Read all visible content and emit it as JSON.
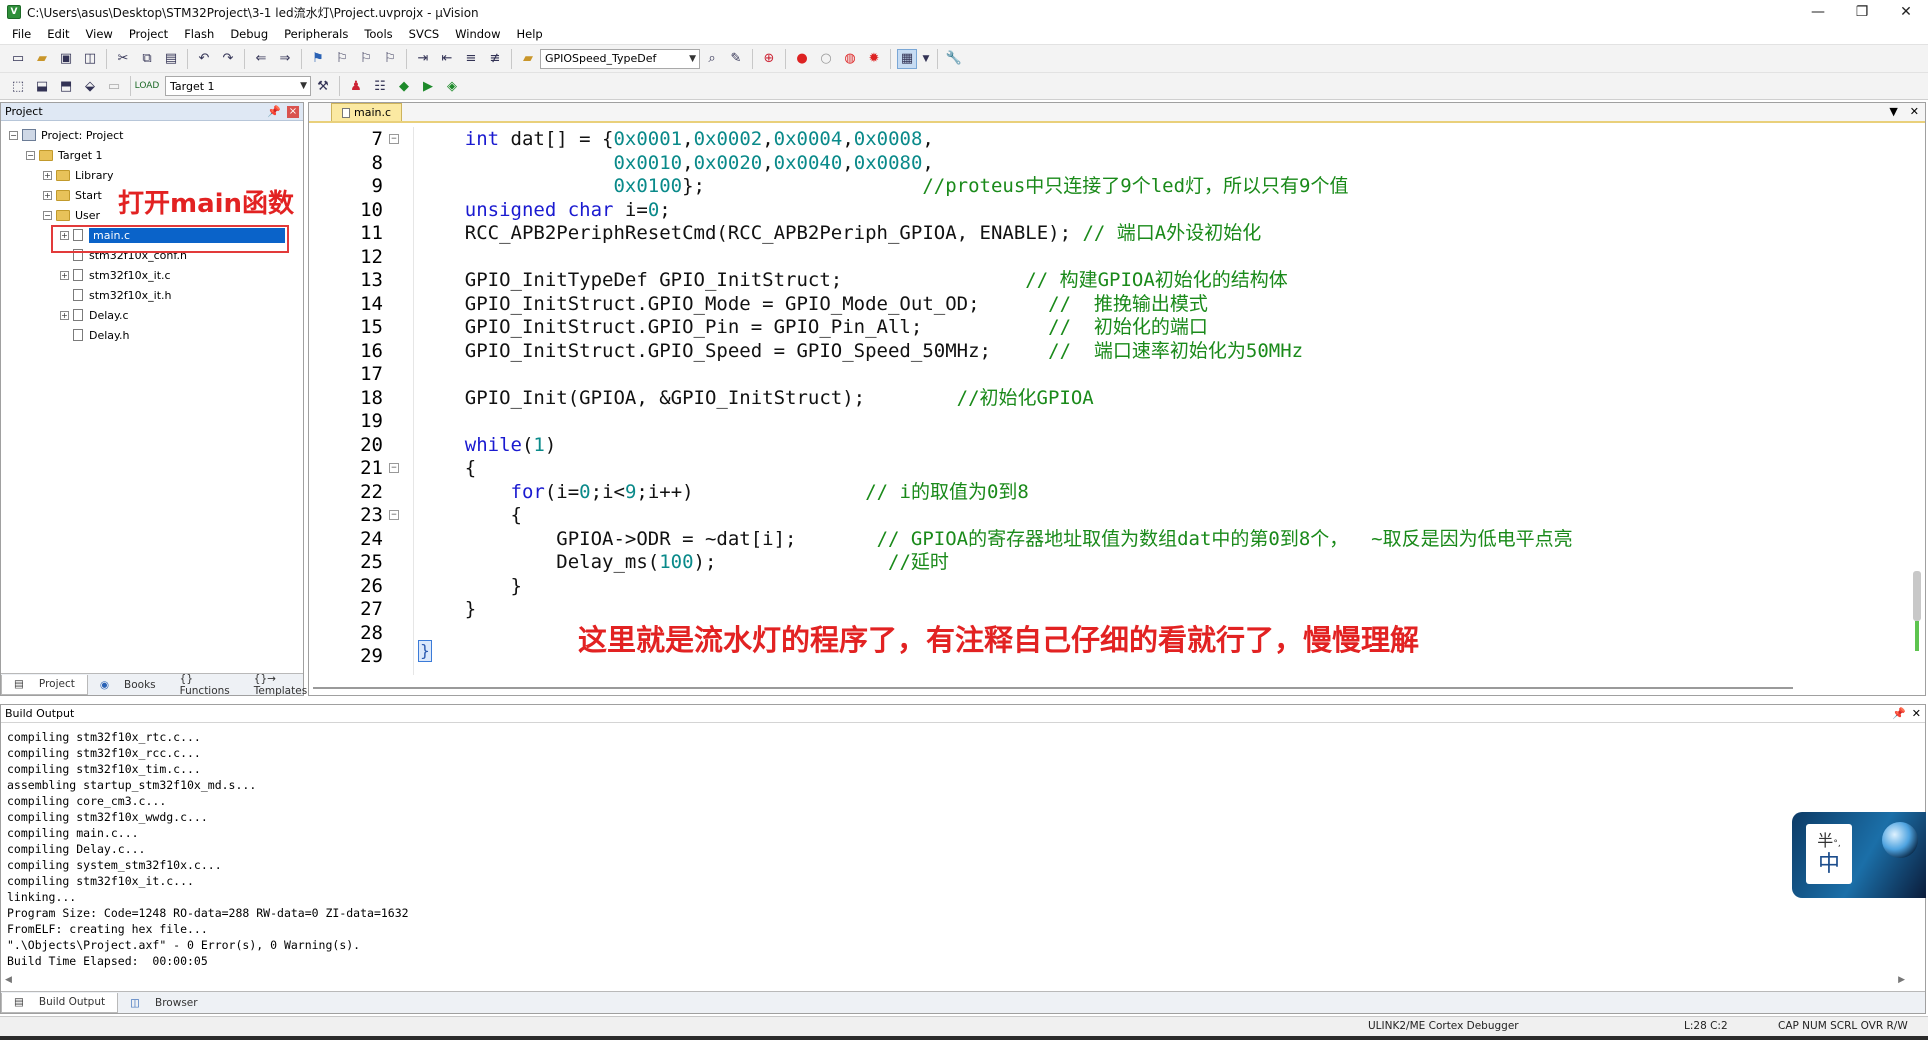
{
  "window": {
    "title": "C:\\Users\\asus\\Desktop\\STM32Project\\3-1 led流水灯\\Project.uvprojx - µVision",
    "controls": [
      "—",
      "❐",
      "✕"
    ]
  },
  "menu": [
    "File",
    "Edit",
    "View",
    "Project",
    "Flash",
    "Debug",
    "Peripherals",
    "Tools",
    "SVCS",
    "Window",
    "Help"
  ],
  "toolbar": {
    "find_combo": "GPIOSpeed_TypeDef",
    "target_combo": "Target 1"
  },
  "project_pane": {
    "header": "Project",
    "tree": [
      {
        "label": "Project: Project",
        "indent": 0,
        "kind": "project",
        "exp": "−"
      },
      {
        "label": "Target 1",
        "indent": 1,
        "kind": "folder",
        "exp": "−"
      },
      {
        "label": "Library",
        "indent": 2,
        "kind": "folder",
        "exp": "+"
      },
      {
        "label": "Start",
        "indent": 2,
        "kind": "folder",
        "exp": "+"
      },
      {
        "label": "User",
        "indent": 2,
        "kind": "folder",
        "exp": "−"
      },
      {
        "label": "main.c",
        "indent": 3,
        "kind": "file",
        "exp": "+",
        "selected": true
      },
      {
        "label": "stm32f10x_conf.h",
        "indent": 3,
        "kind": "file",
        "exp": ""
      },
      {
        "label": "stm32f10x_it.c",
        "indent": 3,
        "kind": "file",
        "exp": "+"
      },
      {
        "label": "stm32f10x_it.h",
        "indent": 3,
        "kind": "file",
        "exp": ""
      },
      {
        "label": "Delay.c",
        "indent": 3,
        "kind": "file",
        "exp": "+"
      },
      {
        "label": "Delay.h",
        "indent": 3,
        "kind": "file",
        "exp": ""
      }
    ],
    "annotation": "打开main函数",
    "tabs": [
      "Project",
      "Books",
      "{} Functions",
      "{}→ Templates"
    ]
  },
  "editor": {
    "tab": "main.c",
    "annotation": "这里就是流水灯的程序了，有注释自己仔细的看就行了，慢慢理解",
    "caret_char": "}",
    "lines": [
      {
        "n": "7",
        "fold": "−",
        "segs": [
          [
            "",
            "    "
          ],
          [
            "kw",
            "int"
          ],
          [
            "",
            " dat[] = {"
          ],
          [
            "num",
            "0x0001"
          ],
          [
            "",
            ","
          ],
          [
            "num",
            "0x0002"
          ],
          [
            "",
            ","
          ],
          [
            "num",
            "0x0004"
          ],
          [
            "",
            ","
          ],
          [
            "num",
            "0x0008"
          ],
          [
            "",
            ","
          ]
        ]
      },
      {
        "n": "8",
        "fold": "",
        "segs": [
          [
            "",
            "                 "
          ],
          [
            "num",
            "0x0010"
          ],
          [
            "",
            ","
          ],
          [
            "num",
            "0x0020"
          ],
          [
            "",
            ","
          ],
          [
            "num",
            "0x0040"
          ],
          [
            "",
            ","
          ],
          [
            "num",
            "0x0080"
          ],
          [
            "",
            ","
          ]
        ]
      },
      {
        "n": "9",
        "fold": "",
        "segs": [
          [
            "",
            "                 "
          ],
          [
            "num",
            "0x0100"
          ],
          [
            "",
            "};                   "
          ],
          [
            "cm",
            "//proteus中只连接了9个led灯，所以只有9个值"
          ]
        ]
      },
      {
        "n": "10",
        "fold": "",
        "segs": [
          [
            "",
            "    "
          ],
          [
            "kw",
            "unsigned char"
          ],
          [
            "",
            " i="
          ],
          [
            "num",
            "0"
          ],
          [
            "",
            ";"
          ]
        ]
      },
      {
        "n": "11",
        "fold": "",
        "segs": [
          [
            "",
            "    RCC_APB2PeriphResetCmd(RCC_APB2Periph_GPIOA, ENABLE); "
          ],
          [
            "cm",
            "// 端口A外设初始化"
          ]
        ]
      },
      {
        "n": "12",
        "fold": "",
        "segs": [
          [
            "",
            ""
          ]
        ]
      },
      {
        "n": "13",
        "fold": "",
        "segs": [
          [
            "",
            "    GPIO_InitTypeDef GPIO_InitStruct;                "
          ],
          [
            "cm",
            "// 构建GPIOA初始化的结构体"
          ]
        ]
      },
      {
        "n": "14",
        "fold": "",
        "segs": [
          [
            "",
            "    GPIO_InitStruct.GPIO_Mode = GPIO_Mode_Out_OD;      "
          ],
          [
            "cm",
            "//  推挽输出模式"
          ]
        ]
      },
      {
        "n": "15",
        "fold": "",
        "segs": [
          [
            "",
            "    GPIO_InitStruct.GPIO_Pin = GPIO_Pin_All;           "
          ],
          [
            "cm",
            "//  初始化的端口"
          ]
        ]
      },
      {
        "n": "16",
        "fold": "",
        "segs": [
          [
            "",
            "    GPIO_InitStruct.GPIO_Speed = GPIO_Speed_50MHz;     "
          ],
          [
            "cm",
            "//  端口速率初始化为50MHz"
          ]
        ]
      },
      {
        "n": "17",
        "fold": "",
        "segs": [
          [
            "",
            ""
          ]
        ]
      },
      {
        "n": "18",
        "fold": "",
        "segs": [
          [
            "",
            "    GPIO_Init(GPIOA, &GPIO_InitStruct);        "
          ],
          [
            "cm",
            "//初始化GPIOA"
          ]
        ]
      },
      {
        "n": "19",
        "fold": "",
        "segs": [
          [
            "",
            ""
          ]
        ]
      },
      {
        "n": "20",
        "fold": "",
        "segs": [
          [
            "",
            "    "
          ],
          [
            "kw",
            "while"
          ],
          [
            "",
            "("
          ],
          [
            "num",
            "1"
          ],
          [
            "",
            ")"
          ]
        ]
      },
      {
        "n": "21",
        "fold": "−",
        "segs": [
          [
            "",
            "    {"
          ]
        ]
      },
      {
        "n": "22",
        "fold": "",
        "segs": [
          [
            "",
            "        "
          ],
          [
            "kw",
            "for"
          ],
          [
            "",
            "(i="
          ],
          [
            "num",
            "0"
          ],
          [
            "",
            ";i<"
          ],
          [
            "num",
            "9"
          ],
          [
            "",
            ";i++)               "
          ],
          [
            "cm",
            "// i的取值为0到8"
          ]
        ]
      },
      {
        "n": "23",
        "fold": "−",
        "segs": [
          [
            "",
            "        {"
          ]
        ]
      },
      {
        "n": "24",
        "fold": "",
        "segs": [
          [
            "",
            "            GPIOA->ODR = ~dat[i];       "
          ],
          [
            "cm",
            "// GPIOA的寄存器地址取值为数组dat中的第0到8个，  ~取反是因为低电平点亮"
          ]
        ]
      },
      {
        "n": "25",
        "fold": "",
        "segs": [
          [
            "",
            "            Delay_ms("
          ],
          [
            "num",
            "100"
          ],
          [
            "",
            ");               "
          ],
          [
            "cm",
            "//延时"
          ]
        ]
      },
      {
        "n": "26",
        "fold": "",
        "segs": [
          [
            "",
            "        }"
          ]
        ]
      },
      {
        "n": "27",
        "fold": "",
        "segs": [
          [
            "",
            "    }"
          ]
        ]
      },
      {
        "n": "28",
        "fold": "",
        "segs": [
          [
            "",
            ""
          ]
        ]
      },
      {
        "n": "29",
        "fold": "",
        "segs": [
          [
            "",
            ""
          ]
        ]
      }
    ]
  },
  "build_output": {
    "header": "Build Output",
    "lines": [
      "compiling stm32f10x_rtc.c...",
      "compiling stm32f10x_rcc.c...",
      "compiling stm32f10x_tim.c...",
      "assembling startup_stm32f10x_md.s...",
      "compiling core_cm3.c...",
      "compiling stm32f10x_wwdg.c...",
      "compiling main.c...",
      "compiling Delay.c...",
      "compiling system_stm32f10x.c...",
      "compiling stm32f10x_it.c...",
      "linking...",
      "Program Size: Code=1248 RO-data=288 RW-data=0 ZI-data=1632",
      "FromELF: creating hex file...",
      "\".\\Objects\\Project.axf\" - 0 Error(s), 0 Warning(s).",
      "Build Time Elapsed:  00:00:05"
    ],
    "tabs": [
      "Build Output",
      "Browser"
    ]
  },
  "ime": {
    "half": "半",
    "small": "°,",
    "zh": "中"
  },
  "status": {
    "debugger": "ULINK2/ME Cortex Debugger",
    "position": "L:28 C:2",
    "keys": "CAP  NUM  SCRL  OVR  R/W"
  }
}
